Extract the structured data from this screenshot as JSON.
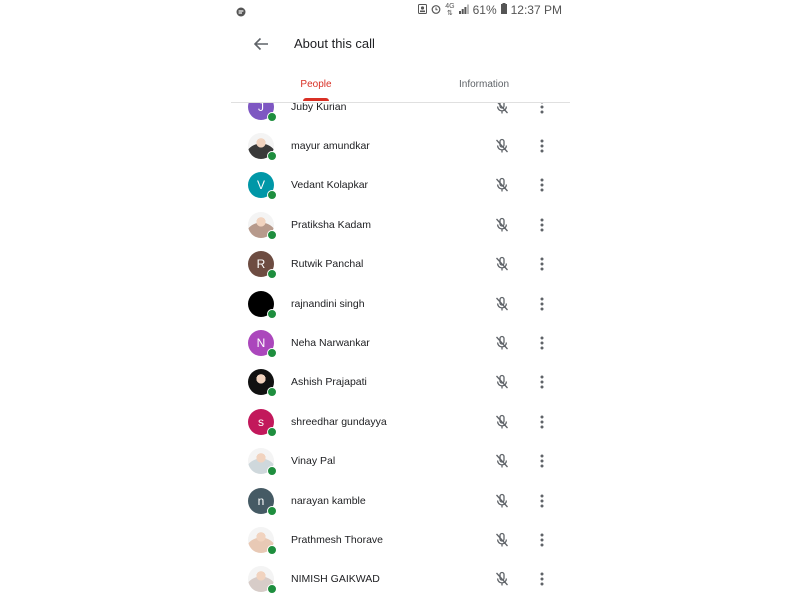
{
  "status_bar": {
    "left_icon": "message-bubble-icon",
    "icons": [
      "contact-icon",
      "alarm-icon",
      "signal-icon",
      "battery-icon"
    ],
    "network_top": "4G",
    "network_bottom": "⇅",
    "battery": "61%",
    "time": "12:37 PM"
  },
  "header": {
    "title": "About this call",
    "back_icon": "arrow-back-icon"
  },
  "tabs": [
    {
      "label": "People",
      "active": true
    },
    {
      "label": "Information",
      "active": false
    }
  ],
  "colors": {
    "accent": "#d93025",
    "presence": "#1e8e3e",
    "icon": "#5f6368",
    "text": "#202124"
  },
  "participants": [
    {
      "name": "Juby Kurian",
      "initial": "J",
      "avatar_color": "#7e57c2",
      "photo": false
    },
    {
      "name": "mayur amundkar",
      "initial": "",
      "avatar_color": "#3a3a3a",
      "photo": true
    },
    {
      "name": "Vedant Kolapkar",
      "initial": "V",
      "avatar_color": "#0097a7",
      "photo": false
    },
    {
      "name": "Pratiksha Kadam",
      "initial": "",
      "avatar_color": "#b79a8c",
      "photo": true
    },
    {
      "name": "Rutwik Panchal",
      "initial": "R",
      "avatar_color": "#6d4c41",
      "photo": false
    },
    {
      "name": "rajnandini singh",
      "initial": "",
      "avatar_color": "#000000",
      "photo": true
    },
    {
      "name": "Neha Narwankar",
      "initial": "N",
      "avatar_color": "#ab47bc",
      "photo": false
    },
    {
      "name": "Ashish Prajapati",
      "initial": "",
      "avatar_color": "#111111",
      "photo": true
    },
    {
      "name": "shreedhar gundayya",
      "initial": "s",
      "avatar_color": "#c2185b",
      "photo": false
    },
    {
      "name": "Vinay Pal",
      "initial": "",
      "avatar_color": "#cfd8dc",
      "photo": true
    },
    {
      "name": "narayan kamble",
      "initial": "n",
      "avatar_color": "#455a64",
      "photo": false
    },
    {
      "name": "Prathmesh Thorave",
      "initial": "",
      "avatar_color": "#e8c9b5",
      "photo": true
    },
    {
      "name": "NIMISH GAIKWAD",
      "initial": "",
      "avatar_color": "#d7ccc8",
      "photo": true
    }
  ],
  "row_icons": {
    "mic": "mic-off-icon",
    "more": "more-vert-icon"
  }
}
